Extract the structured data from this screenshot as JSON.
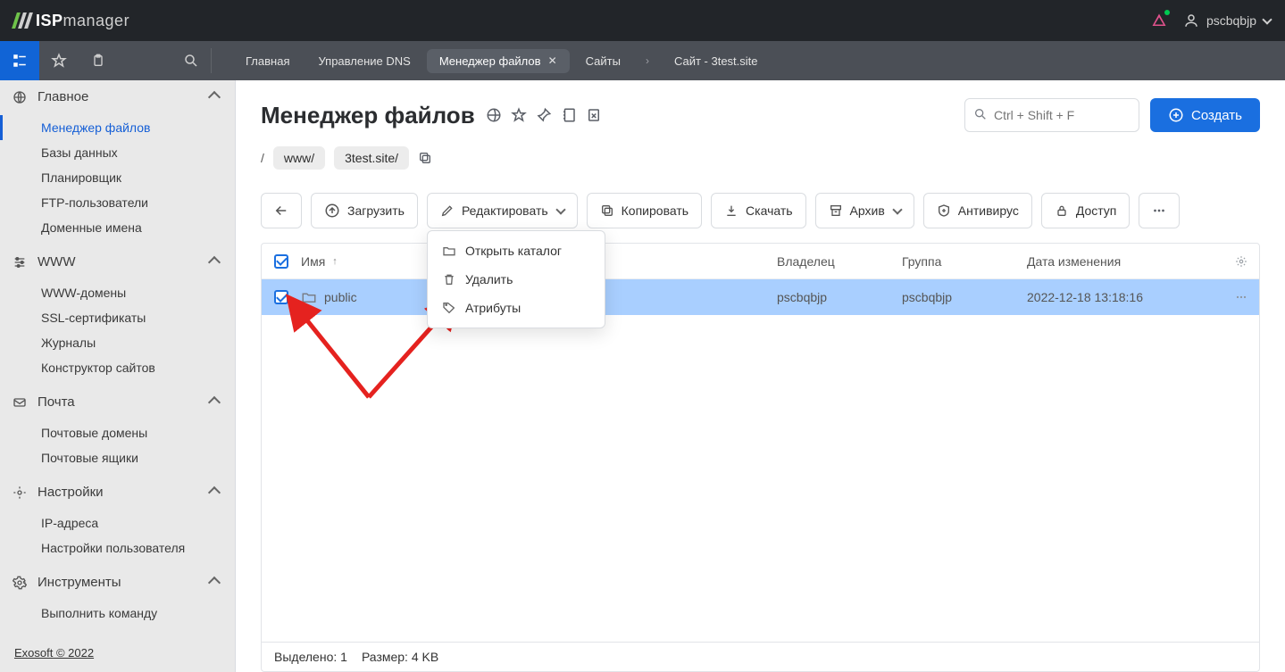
{
  "brand": {
    "isp": "ISP",
    "manager": "manager"
  },
  "user": {
    "name": "pscbqbjp"
  },
  "tabs": {
    "home": "Главная",
    "dns": "Управление DNS",
    "filemgr": "Менеджер файлов",
    "sites": "Сайты",
    "site_current": "Сайт - 3test.site"
  },
  "sidebar": {
    "main": {
      "title": "Главное",
      "items": [
        "Менеджер файлов",
        "Базы данных",
        "Планировщик",
        "FTP-пользователи",
        "Доменные имена"
      ]
    },
    "www": {
      "title": "WWW",
      "items": [
        "WWW-домены",
        "SSL-сертификаты",
        "Журналы",
        "Конструктор сайтов"
      ]
    },
    "mail": {
      "title": "Почта",
      "items": [
        "Почтовые домены",
        "Почтовые ящики"
      ]
    },
    "settings": {
      "title": "Настройки",
      "items": [
        "IP-адреса",
        "Настройки пользователя"
      ]
    },
    "tools": {
      "title": "Инструменты",
      "items": [
        "Выполнить команду"
      ]
    }
  },
  "footer": "Exosoft © 2022",
  "page": {
    "title": "Менеджер файлов",
    "search_placeholder": "Ctrl + Shift + F",
    "create": "Создать"
  },
  "breadcrumb": {
    "root": "/",
    "parts": [
      "www/",
      "3test.site/"
    ]
  },
  "toolbar": {
    "upload": "Загрузить",
    "edit": "Редактировать",
    "copy": "Копировать",
    "download": "Скачать",
    "archive": "Архив",
    "antivirus": "Антивирус",
    "access": "Доступ"
  },
  "dropdown": {
    "open": "Открыть каталог",
    "delete": "Удалить",
    "attrs": "Атрибуты"
  },
  "columns": {
    "name": "Имя",
    "owner": "Владелец",
    "group": "Группа",
    "date": "Дата изменения"
  },
  "sort_indicator": "↑",
  "rows": [
    {
      "name": "public",
      "owner": "pscbqbjp",
      "group": "pscbqbjp",
      "date": "2022-12-18 13:18:16"
    }
  ],
  "status": {
    "selected": "Выделено: 1",
    "size": "Размер: 4 KB"
  }
}
